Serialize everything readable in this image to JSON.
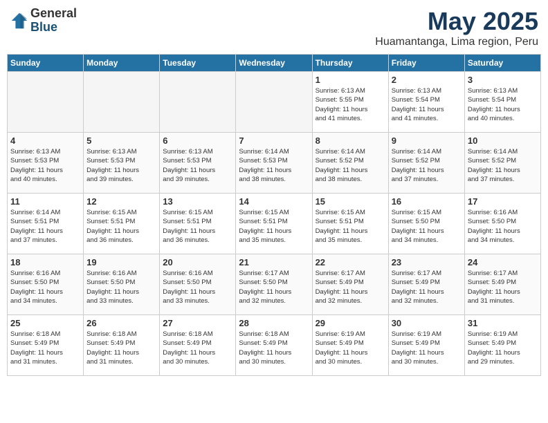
{
  "header": {
    "logo_line1": "General",
    "logo_line2": "Blue",
    "month": "May 2025",
    "location": "Huamantanga, Lima region, Peru"
  },
  "days_of_week": [
    "Sunday",
    "Monday",
    "Tuesday",
    "Wednesday",
    "Thursday",
    "Friday",
    "Saturday"
  ],
  "weeks": [
    [
      {
        "day": "",
        "info": ""
      },
      {
        "day": "",
        "info": ""
      },
      {
        "day": "",
        "info": ""
      },
      {
        "day": "",
        "info": ""
      },
      {
        "day": "1",
        "info": "Sunrise: 6:13 AM\nSunset: 5:55 PM\nDaylight: 11 hours\nand 41 minutes."
      },
      {
        "day": "2",
        "info": "Sunrise: 6:13 AM\nSunset: 5:54 PM\nDaylight: 11 hours\nand 41 minutes."
      },
      {
        "day": "3",
        "info": "Sunrise: 6:13 AM\nSunset: 5:54 PM\nDaylight: 11 hours\nand 40 minutes."
      }
    ],
    [
      {
        "day": "4",
        "info": "Sunrise: 6:13 AM\nSunset: 5:53 PM\nDaylight: 11 hours\nand 40 minutes."
      },
      {
        "day": "5",
        "info": "Sunrise: 6:13 AM\nSunset: 5:53 PM\nDaylight: 11 hours\nand 39 minutes."
      },
      {
        "day": "6",
        "info": "Sunrise: 6:13 AM\nSunset: 5:53 PM\nDaylight: 11 hours\nand 39 minutes."
      },
      {
        "day": "7",
        "info": "Sunrise: 6:14 AM\nSunset: 5:53 PM\nDaylight: 11 hours\nand 38 minutes."
      },
      {
        "day": "8",
        "info": "Sunrise: 6:14 AM\nSunset: 5:52 PM\nDaylight: 11 hours\nand 38 minutes."
      },
      {
        "day": "9",
        "info": "Sunrise: 6:14 AM\nSunset: 5:52 PM\nDaylight: 11 hours\nand 37 minutes."
      },
      {
        "day": "10",
        "info": "Sunrise: 6:14 AM\nSunset: 5:52 PM\nDaylight: 11 hours\nand 37 minutes."
      }
    ],
    [
      {
        "day": "11",
        "info": "Sunrise: 6:14 AM\nSunset: 5:51 PM\nDaylight: 11 hours\nand 37 minutes."
      },
      {
        "day": "12",
        "info": "Sunrise: 6:15 AM\nSunset: 5:51 PM\nDaylight: 11 hours\nand 36 minutes."
      },
      {
        "day": "13",
        "info": "Sunrise: 6:15 AM\nSunset: 5:51 PM\nDaylight: 11 hours\nand 36 minutes."
      },
      {
        "day": "14",
        "info": "Sunrise: 6:15 AM\nSunset: 5:51 PM\nDaylight: 11 hours\nand 35 minutes."
      },
      {
        "day": "15",
        "info": "Sunrise: 6:15 AM\nSunset: 5:51 PM\nDaylight: 11 hours\nand 35 minutes."
      },
      {
        "day": "16",
        "info": "Sunrise: 6:15 AM\nSunset: 5:50 PM\nDaylight: 11 hours\nand 34 minutes."
      },
      {
        "day": "17",
        "info": "Sunrise: 6:16 AM\nSunset: 5:50 PM\nDaylight: 11 hours\nand 34 minutes."
      }
    ],
    [
      {
        "day": "18",
        "info": "Sunrise: 6:16 AM\nSunset: 5:50 PM\nDaylight: 11 hours\nand 34 minutes."
      },
      {
        "day": "19",
        "info": "Sunrise: 6:16 AM\nSunset: 5:50 PM\nDaylight: 11 hours\nand 33 minutes."
      },
      {
        "day": "20",
        "info": "Sunrise: 6:16 AM\nSunset: 5:50 PM\nDaylight: 11 hours\nand 33 minutes."
      },
      {
        "day": "21",
        "info": "Sunrise: 6:17 AM\nSunset: 5:50 PM\nDaylight: 11 hours\nand 32 minutes."
      },
      {
        "day": "22",
        "info": "Sunrise: 6:17 AM\nSunset: 5:49 PM\nDaylight: 11 hours\nand 32 minutes."
      },
      {
        "day": "23",
        "info": "Sunrise: 6:17 AM\nSunset: 5:49 PM\nDaylight: 11 hours\nand 32 minutes."
      },
      {
        "day": "24",
        "info": "Sunrise: 6:17 AM\nSunset: 5:49 PM\nDaylight: 11 hours\nand 31 minutes."
      }
    ],
    [
      {
        "day": "25",
        "info": "Sunrise: 6:18 AM\nSunset: 5:49 PM\nDaylight: 11 hours\nand 31 minutes."
      },
      {
        "day": "26",
        "info": "Sunrise: 6:18 AM\nSunset: 5:49 PM\nDaylight: 11 hours\nand 31 minutes."
      },
      {
        "day": "27",
        "info": "Sunrise: 6:18 AM\nSunset: 5:49 PM\nDaylight: 11 hours\nand 30 minutes."
      },
      {
        "day": "28",
        "info": "Sunrise: 6:18 AM\nSunset: 5:49 PM\nDaylight: 11 hours\nand 30 minutes."
      },
      {
        "day": "29",
        "info": "Sunrise: 6:19 AM\nSunset: 5:49 PM\nDaylight: 11 hours\nand 30 minutes."
      },
      {
        "day": "30",
        "info": "Sunrise: 6:19 AM\nSunset: 5:49 PM\nDaylight: 11 hours\nand 30 minutes."
      },
      {
        "day": "31",
        "info": "Sunrise: 6:19 AM\nSunset: 5:49 PM\nDaylight: 11 hours\nand 29 minutes."
      }
    ]
  ]
}
